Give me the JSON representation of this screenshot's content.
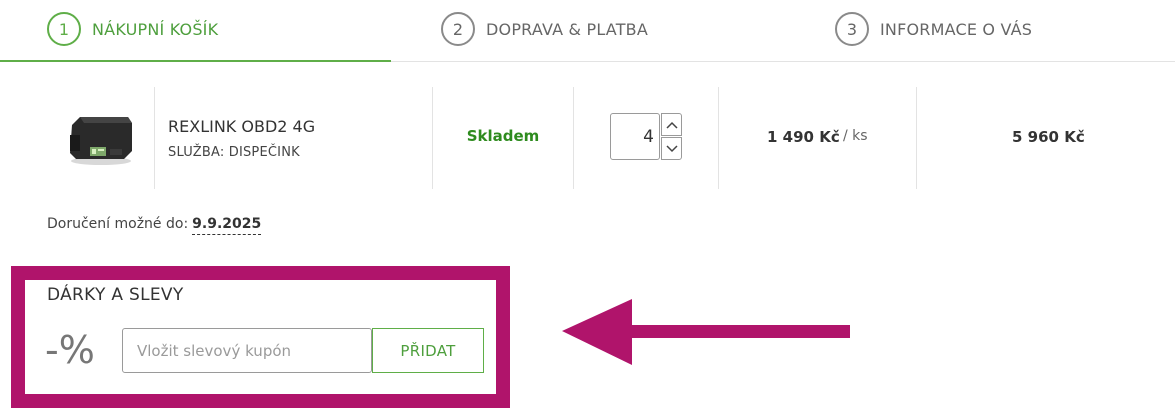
{
  "steps": [
    {
      "number": "1",
      "label": "NÁKUPNÍ KOŠÍK",
      "active": true
    },
    {
      "number": "2",
      "label": "DOPRAVA & PLATBA",
      "active": false
    },
    {
      "number": "3",
      "label": "INFORMACE O VÁS",
      "active": false
    }
  ],
  "cart": {
    "item": {
      "name": "REXLINK OBD2 4G",
      "service": "SLUŽBA: DISPEČINK",
      "stock": "Skladem",
      "quantity": "4",
      "unit_price": "1 490 Kč",
      "unit": "/ ks",
      "total": "5 960 Kč"
    }
  },
  "delivery": {
    "label": "Doručení možné do:",
    "date": "9.9.2025"
  },
  "gifts": {
    "title": "DÁRKY A SLEVY",
    "percent_symbol": "-%",
    "coupon_placeholder": "Vložit slevový kupón",
    "coupon_value": "",
    "add_label": "PŘIDAT"
  },
  "colors": {
    "accent_green": "#5fae48",
    "stock_green": "#2e8b1e",
    "highlight_magenta": "#b0146b"
  },
  "icons": {
    "qty_up": "chevron-up-icon",
    "qty_down": "chevron-down-icon",
    "annotation": "arrow-left-icon"
  }
}
